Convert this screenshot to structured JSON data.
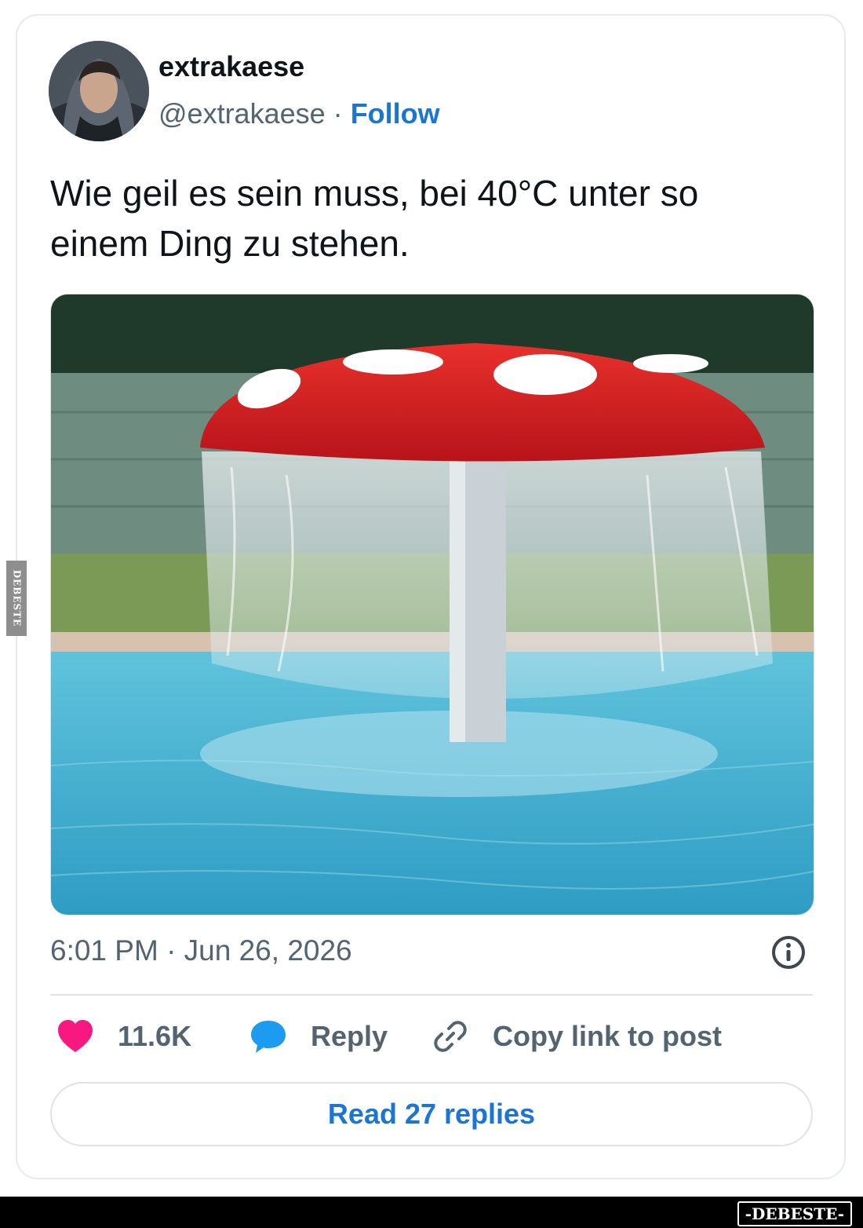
{
  "post": {
    "author_name": "extrakaese",
    "handle": "@extrakaese",
    "separator": "·",
    "follow_label": "Follow",
    "text_line1": "Wie geil es sein muss, bei 40°C unter so",
    "text_line2": "einem Ding zu stehen.",
    "timestamp": "6:01 PM · Jun 26, 2026"
  },
  "actions": {
    "likes_count": "11.6K",
    "reply_label": "Reply",
    "copy_link_label": "Copy link to post",
    "read_replies_label": "Read 27 replies"
  },
  "icons": {
    "like": "heart-icon",
    "reply": "speech-bubble-icon",
    "copy_link": "link-icon",
    "info": "info-icon"
  },
  "colors": {
    "like": "#f91880",
    "reply": "#1d9bf0",
    "link_text": "#1a76d2",
    "muted": "#536471"
  },
  "watermark": {
    "side": "DEBESTE",
    "footer": "-DEBESTE-"
  }
}
